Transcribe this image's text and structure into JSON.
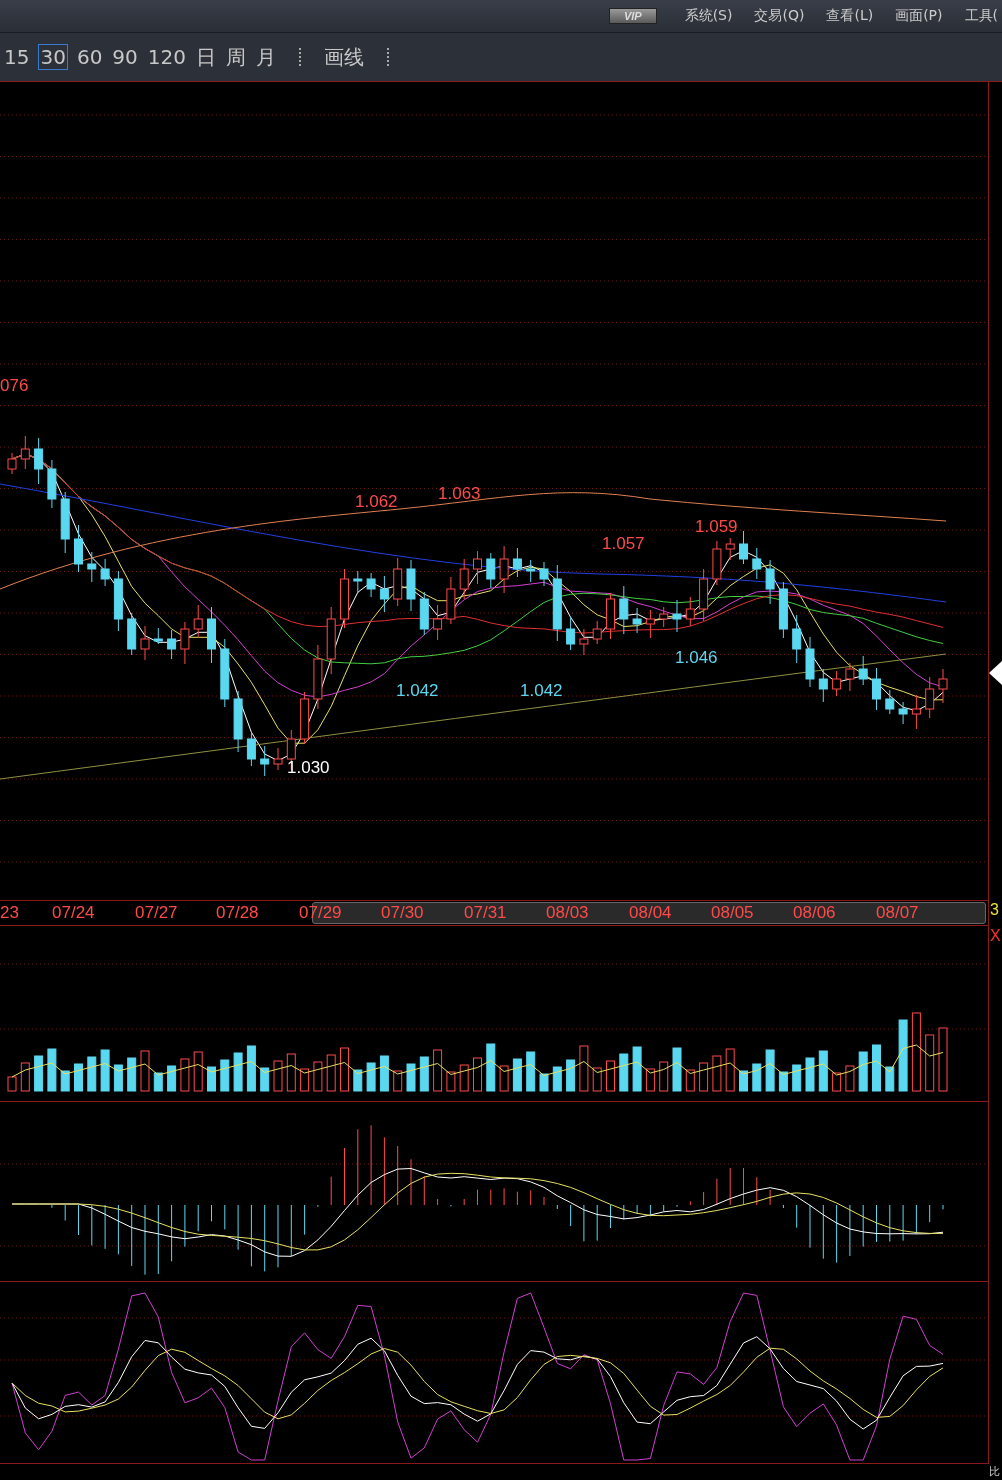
{
  "menu_bar": {
    "badge": "VIP",
    "items": [
      "系统(S)",
      "交易(Q)",
      "查看(L)",
      "画面(P)",
      "工具("
    ]
  },
  "toolbar": {
    "periods": [
      {
        "label": "15",
        "selected": false
      },
      {
        "label": "30",
        "selected": true
      },
      {
        "label": "60",
        "selected": false
      },
      {
        "label": "90",
        "selected": false
      },
      {
        "label": "120",
        "selected": false
      },
      {
        "label": "日",
        "selected": false
      },
      {
        "label": "周",
        "selected": false
      },
      {
        "label": "月",
        "selected": false
      }
    ],
    "tools": [
      "画线"
    ]
  },
  "chart": {
    "price_labels": [
      {
        "text": "076",
        "kind": "high"
      },
      {
        "text": "1.062",
        "kind": "high"
      },
      {
        "text": "1.063",
        "kind": "high"
      },
      {
        "text": "1.057",
        "kind": "high"
      },
      {
        "text": "1.059",
        "kind": "high"
      },
      {
        "text": "1.042",
        "kind": "low"
      },
      {
        "text": "1.042",
        "kind": "low"
      },
      {
        "text": "1.046",
        "kind": "low"
      },
      {
        "text": "1.030",
        "kind": "lowest"
      }
    ],
    "dates": [
      "23",
      "07/24",
      "07/27",
      "07/28",
      "07/29",
      "07/30",
      "07/31",
      "08/03",
      "08/04",
      "08/05",
      "08/06",
      "08/07"
    ],
    "side_labels": [
      {
        "text": "3",
        "kind": "value"
      },
      {
        "text": "X",
        "kind": "close"
      }
    ],
    "footer_label": "比"
  }
}
